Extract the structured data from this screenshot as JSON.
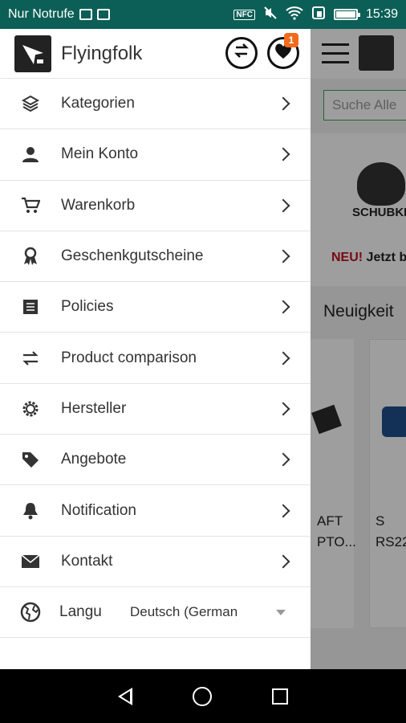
{
  "status_bar": {
    "carrier": "Nur Notrufe",
    "nfc": "NFC",
    "time": "15:39"
  },
  "header": {
    "app_title": "Flyingfolk",
    "cart_badge": "1"
  },
  "menu": {
    "items": [
      {
        "label": "Kategorien",
        "icon": "layers-icon"
      },
      {
        "label": "Mein Konto",
        "icon": "person-icon"
      },
      {
        "label": "Warenkorb",
        "icon": "cart-icon"
      },
      {
        "label": "Geschenkgutscheine",
        "icon": "award-icon"
      },
      {
        "label": "Policies",
        "icon": "document-icon"
      },
      {
        "label": "Product comparison",
        "icon": "swap-icon"
      },
      {
        "label": "Hersteller",
        "icon": "gear-icon"
      },
      {
        "label": "Angebote",
        "icon": "tag-icon"
      },
      {
        "label": "Notification",
        "icon": "bell-icon"
      },
      {
        "label": "Kontakt",
        "icon": "mail-icon"
      }
    ],
    "language": {
      "label": "Langu",
      "selected": "Deutsch (German"
    }
  },
  "background": {
    "search_placeholder": "Suche Alle",
    "banner_brand": "SCHUBKR",
    "banner_new": "NEU!",
    "banner_rest": " Jetzt b",
    "section_title": "Neuigkeit",
    "product1_line1": "AFT",
    "product1_line2": "PTO...",
    "product2_line1": "S",
    "product2_line2": "RS22"
  }
}
